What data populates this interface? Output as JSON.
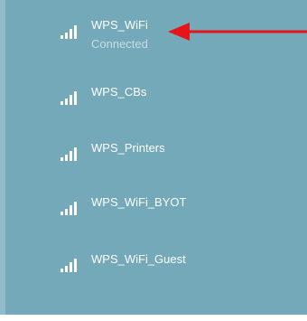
{
  "colors": {
    "panel_bg": "#73a9b8",
    "text_primary": "#ffffff",
    "text_secondary": "#c8dde3",
    "arrow": "#e8141b"
  },
  "networks": [
    {
      "ssid": "WPS_WiFi",
      "status": "Connected",
      "icon": "wifi-signal-icon"
    },
    {
      "ssid": "WPS_CBs",
      "icon": "wifi-signal-icon"
    },
    {
      "ssid": "WPS_Printers",
      "icon": "wifi-signal-icon"
    },
    {
      "ssid": "WPS_WiFi_BYOT",
      "icon": "wifi-signal-icon"
    },
    {
      "ssid": "WPS_WiFi_Guest",
      "icon": "wifi-signal-icon"
    }
  ],
  "annotation": {
    "icon": "red-arrow-icon"
  }
}
